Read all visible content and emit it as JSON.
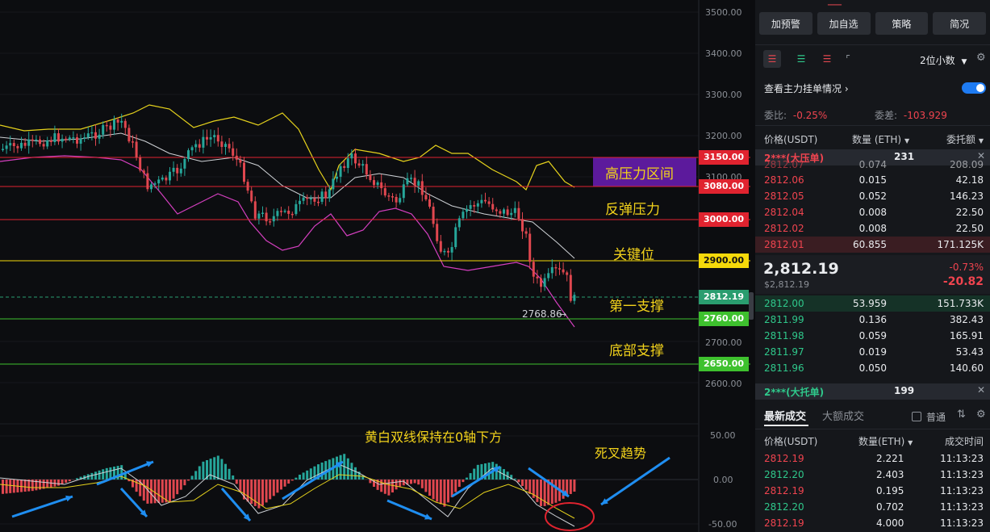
{
  "chart": {
    "price_axis_labels": [
      "3500.00",
      "3400.00",
      "3300.00",
      "3200.00",
      "3100.00",
      "2700.00",
      "2600.00"
    ],
    "level_tags": [
      {
        "label": "3150.00",
        "color": "#e0232f"
      },
      {
        "label": "3080.00",
        "color": "#e0232f"
      },
      {
        "label": "3000.00",
        "color": "#e0232f"
      },
      {
        "label": "2900.00",
        "color": "#f5d90a"
      },
      {
        "label": "2812.19",
        "color": "#2a9d6f"
      },
      {
        "label": "2760.00",
        "color": "#3ec12e"
      },
      {
        "label": "2650.00",
        "color": "#3ec12e"
      }
    ],
    "macd_axis_labels": [
      "50.00",
      "0.00",
      "-50.00"
    ],
    "low_marker": "2768.86",
    "annotations": {
      "high_pressure_zone": "高压力区间",
      "rebound_pressure": "反弹压力",
      "key_level": "关键位",
      "first_support": "第一支撑",
      "bottom_support": "底部支撑",
      "dual_line_note": "黄白双线保持在0轴下方",
      "death_cross": "死叉趋势"
    },
    "colors": {
      "up": "#26a69a",
      "down": "#e0474f",
      "yellow_line": "#e6d21c",
      "white_line": "#cfd2d6",
      "pink_line": "#d43fbf",
      "arrow": "#1f8ef1"
    }
  },
  "panel": {
    "top_buttons": [
      "加预警",
      "加自选",
      "策略",
      "简况"
    ],
    "precision": "2位小数",
    "main_orders_label": "查看主力挂单情况",
    "ratio_label": "委比:",
    "ratio_value": "-0.25%",
    "diff_label": "委差:",
    "diff_value": "-103.929",
    "book_headers": [
      "价格(USDT)",
      "数量 (ETH)",
      "委托额"
    ],
    "big_ask_label": "2***(大压单)",
    "big_ask_qty": "231",
    "asks": [
      [
        "2812.07",
        "0.074",
        "208.09"
      ],
      [
        "2812.06",
        "0.015",
        "42.18"
      ],
      [
        "2812.05",
        "0.052",
        "146.23"
      ],
      [
        "2812.04",
        "0.008",
        "22.50"
      ],
      [
        "2812.02",
        "0.008",
        "22.50"
      ],
      [
        "2812.01",
        "60.855",
        "171.125K"
      ]
    ],
    "last_price": "2,812.19",
    "last_price_usd": "$2,812.19",
    "change_pct": "-0.73%",
    "change_abs": "-20.82",
    "bids": [
      [
        "2812.00",
        "53.959",
        "151.733K"
      ],
      [
        "2811.99",
        "0.136",
        "382.43"
      ],
      [
        "2811.98",
        "0.059",
        "165.91"
      ],
      [
        "2811.97",
        "0.019",
        "53.43"
      ],
      [
        "2811.96",
        "0.050",
        "140.60"
      ]
    ],
    "big_bid_label": "2***(大托单)",
    "big_bid_qty": "199",
    "trade_tabs": [
      "最新成交",
      "大额成交"
    ],
    "normal_label": "普通",
    "trade_headers": [
      "价格(USDT)",
      "数量(ETH)",
      "成交时间"
    ],
    "trades": [
      [
        "2812.19",
        "2.221",
        "11:13:23",
        "down"
      ],
      [
        "2812.20",
        "2.403",
        "11:13:23",
        "up"
      ],
      [
        "2812.19",
        "0.195",
        "11:13:23",
        "down"
      ],
      [
        "2812.20",
        "0.702",
        "11:13:23",
        "up"
      ],
      [
        "2812.19",
        "4.000",
        "11:13:23",
        "down"
      ]
    ]
  }
}
